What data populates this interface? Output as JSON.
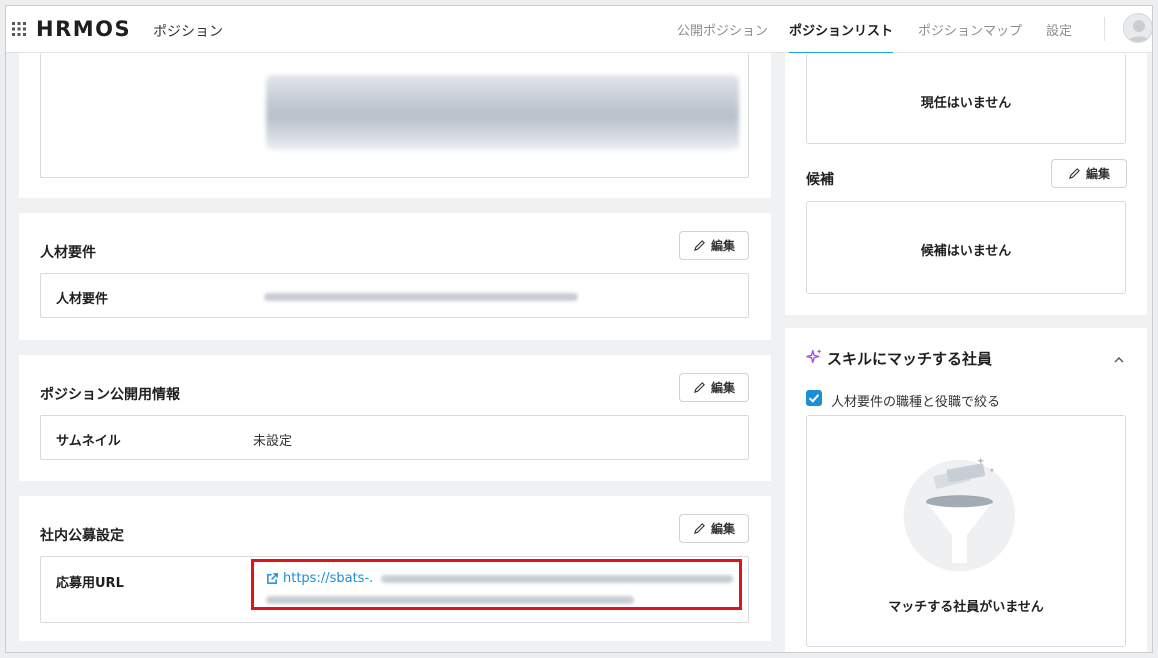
{
  "header": {
    "brand": "HRMOS",
    "product": "ポジション",
    "nav": [
      {
        "label": "公開ポジション",
        "active": false
      },
      {
        "label": "ポジションリスト",
        "active": true
      },
      {
        "label": "ポジションマップ",
        "active": false
      },
      {
        "label": "設定",
        "active": false
      }
    ]
  },
  "left": {
    "requirements": {
      "title": "人材要件",
      "edit_label": "編集",
      "field_label": "人材要件"
    },
    "public_info": {
      "title": "ポジション公開用情報",
      "edit_label": "編集",
      "thumbnail_label": "サムネイル",
      "thumbnail_value": "未設定"
    },
    "internal_recruit": {
      "title": "社内公募設定",
      "edit_label": "編集",
      "url_label": "応募用URL",
      "url_text": "https://sbats-."
    }
  },
  "right": {
    "current_empty": "現任はいません",
    "candidates_title": "候補",
    "candidates_edit_label": "編集",
    "candidates_empty": "候補はいません",
    "skill_match": {
      "title": "スキルにマッチする社員",
      "filter_label": "人材要件の職種と役職で絞る",
      "filter_checked": true,
      "empty": "マッチする社員がいません"
    }
  },
  "colors": {
    "accent": "#1da1e6",
    "link": "#1a8fd6",
    "highlight": "#e1141b",
    "sparkle": "#a24fe0"
  },
  "icons": [
    "apps-grid-icon",
    "pencil-icon",
    "external-link-icon",
    "sparkle-icon",
    "chevron-up-icon",
    "check-icon",
    "funnel-illustration"
  ]
}
